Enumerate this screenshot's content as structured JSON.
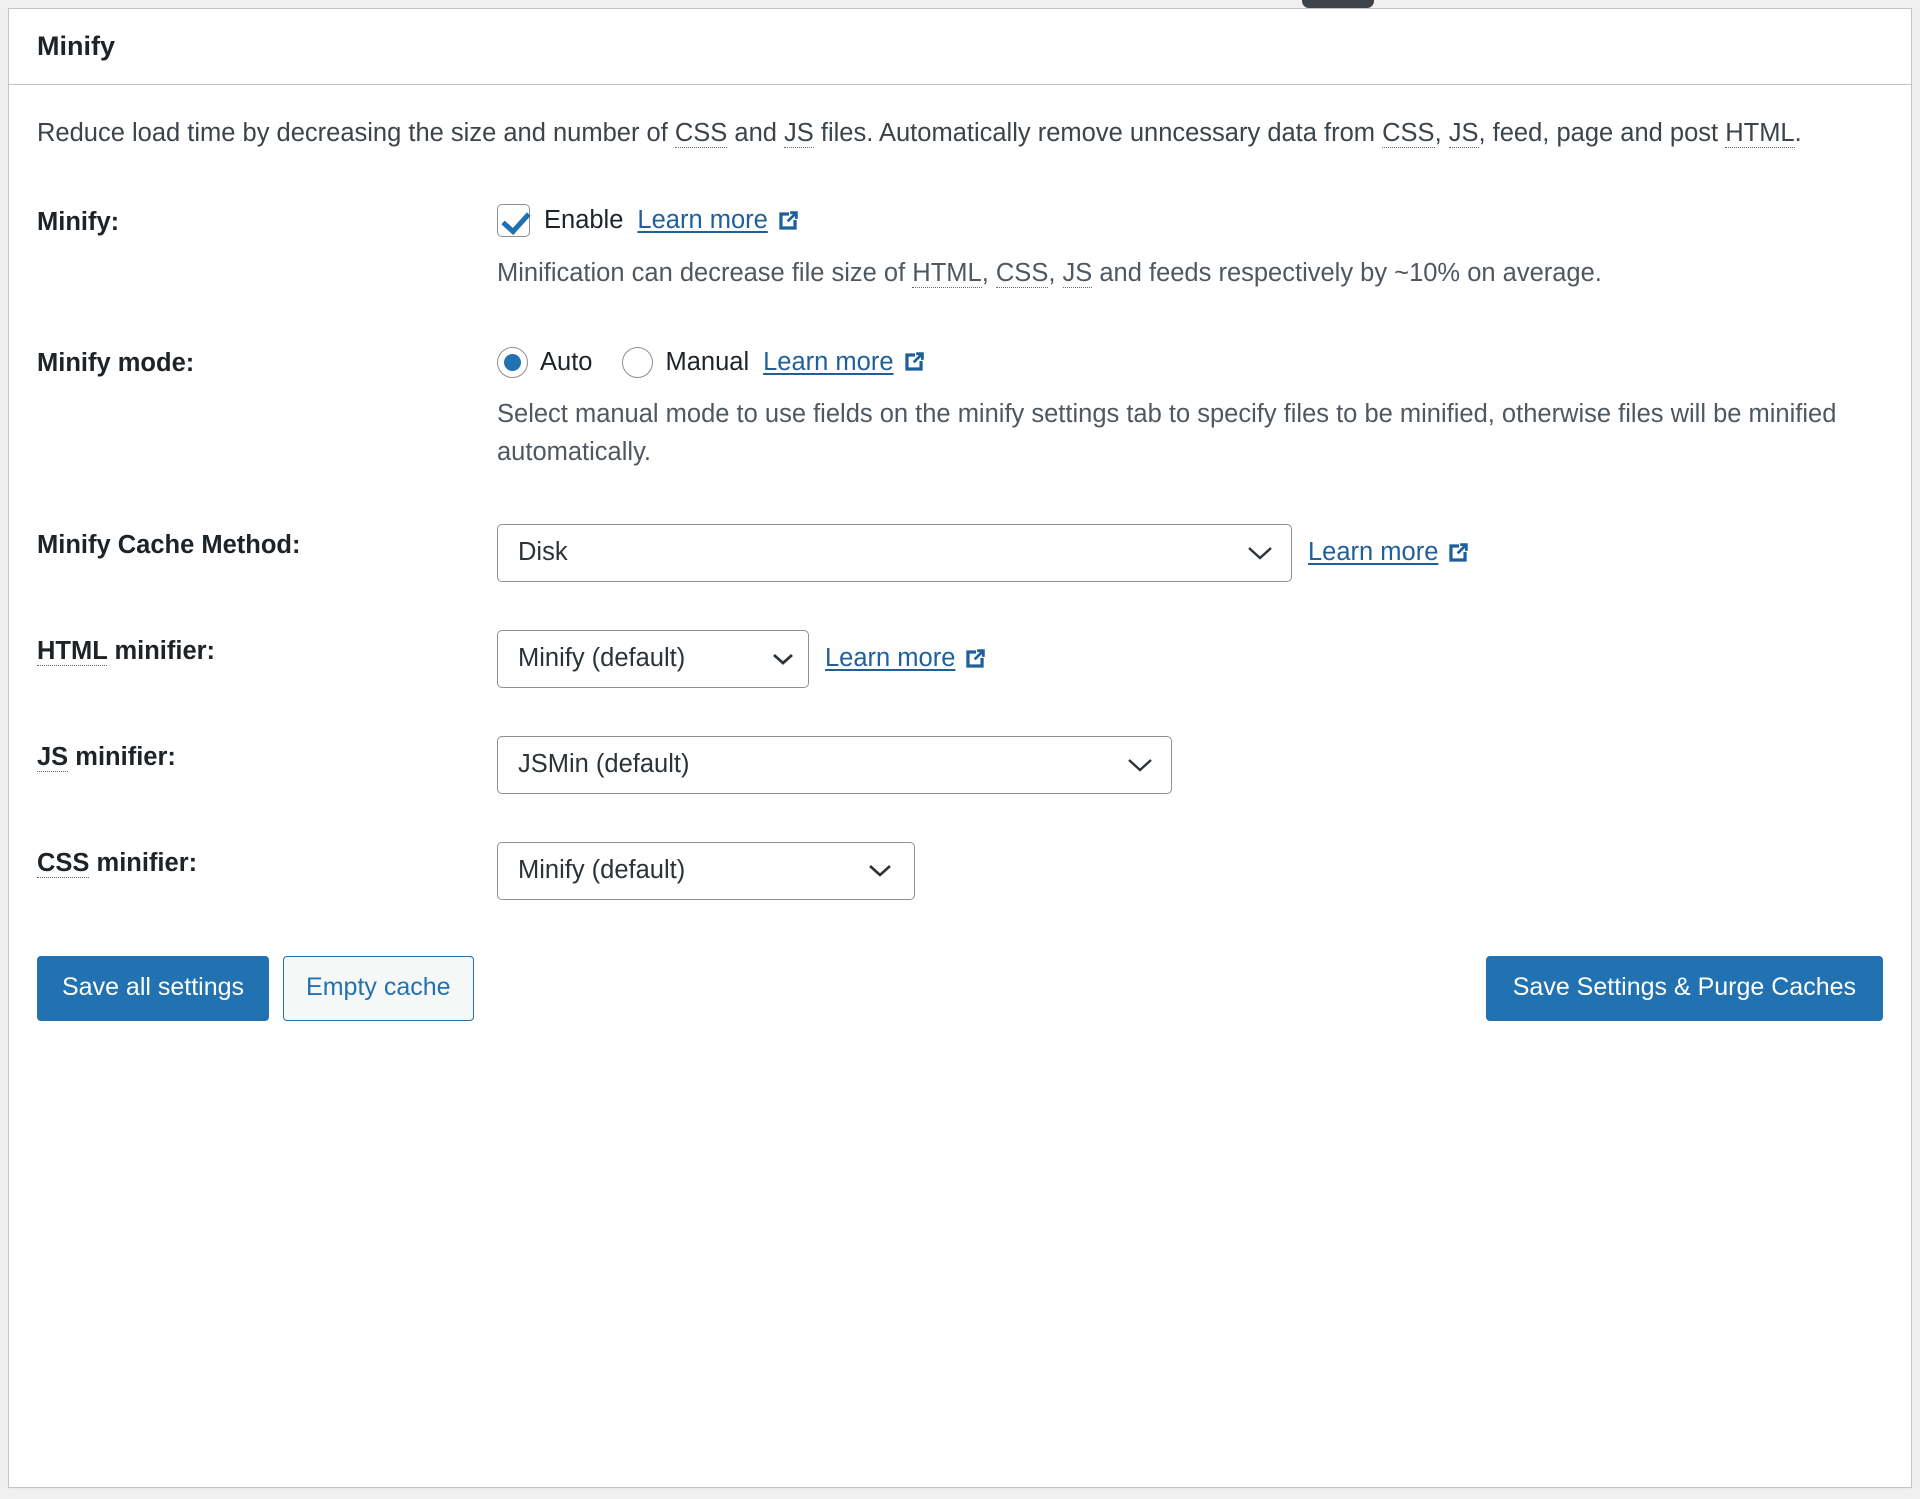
{
  "panel": {
    "title": "Minify",
    "intro": {
      "part1": "Reduce load time by decreasing the size and number of ",
      "abbr_css1": "CSS",
      "part2": " and ",
      "abbr_js1": "JS",
      "part3": " files. Automatically remove unncessary data from ",
      "abbr_css2": "CSS",
      "part4": ", ",
      "abbr_js2": "JS",
      "part5": ", feed, page and post ",
      "abbr_html": "HTML",
      "part6": "."
    }
  },
  "rows": {
    "minify": {
      "label": "Minify:",
      "checkbox_label": "Enable",
      "checkbox_checked": true,
      "learn_more": "Learn more",
      "description": "Minification can decrease file size of ",
      "desc_abbr_html": "HTML",
      "desc_sep1": ", ",
      "desc_abbr_css": "CSS",
      "desc_sep2": ", ",
      "desc_abbr_js": "JS",
      "desc_tail": " and feeds respectively by ~10% on average."
    },
    "minify_mode": {
      "label": "Minify mode:",
      "option_auto": "Auto",
      "option_manual": "Manual",
      "selected": "Auto",
      "learn_more": "Learn more",
      "description": "Select manual mode to use fields on the minify settings tab to specify files to be minified, otherwise files will be minified automatically."
    },
    "minify_cache_method": {
      "label": "Minify Cache Method:",
      "value": "Disk",
      "options": [
        "Disk"
      ],
      "learn_more": "Learn more"
    },
    "html_minifier": {
      "label_abbr": "HTML",
      "label_rest": " minifier:",
      "value": "Minify (default)",
      "options": [
        "Minify (default)"
      ],
      "learn_more": "Learn more"
    },
    "js_minifier": {
      "label_abbr": "JS",
      "label_rest": " minifier:",
      "value": "JSMin (default)",
      "options": [
        "JSMin (default)"
      ]
    },
    "css_minifier": {
      "label_abbr": "CSS",
      "label_rest": " minifier:",
      "value": "Minify (default)",
      "options": [
        "Minify (default)"
      ]
    }
  },
  "footer": {
    "save_all_settings": "Save all settings",
    "empty_cache": "Empty cache",
    "save_purge": "Save Settings & Purge Caches"
  },
  "colors": {
    "accent_blue": "#2271b1",
    "link_blue": "#1f5f9c",
    "border_gray": "#c3c4c7",
    "text_dark": "#1d2327",
    "text_muted": "#50575e",
    "tooltip_dark": "#3c434a"
  }
}
